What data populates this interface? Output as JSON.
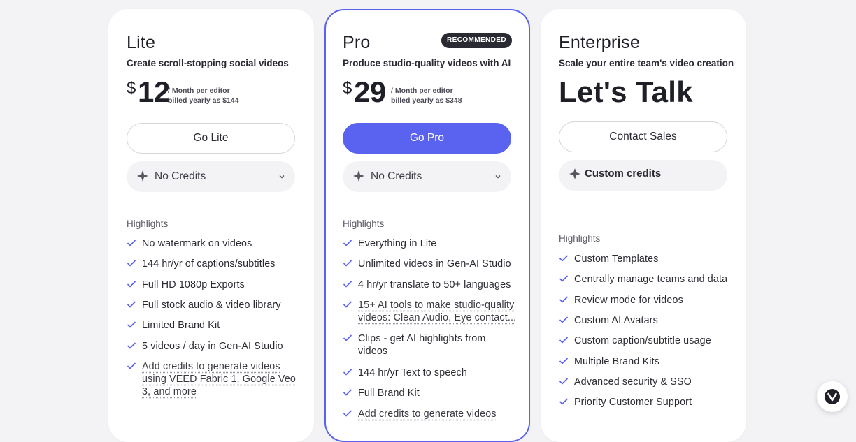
{
  "plans": {
    "lite": {
      "name": "Lite",
      "tagline": "Create scroll-stopping social videos",
      "currency": "$",
      "price": "12",
      "price_note_1": "/ Month per editor",
      "price_note_2": "billed yearly as $144",
      "cta": "Go Lite",
      "credits_label": "No Credits",
      "highlights_title": "Highlights",
      "features": [
        "No watermark on videos",
        "144 hr/yr of captions/subtitles",
        "Full HD 1080p Exports",
        "Full stock audio & video library",
        "Limited Brand Kit",
        "5 videos / day in Gen-AI Studio",
        "Add credits to generate videos using VEED Fabric 1, Google Veo 3, and more"
      ]
    },
    "pro": {
      "name": "Pro",
      "badge": "RECOMMENDED",
      "tagline": "Produce studio-quality videos with AI",
      "currency": "$",
      "price": "29",
      "price_note_1": "/ Month per editor",
      "price_note_2": "billed yearly as $348",
      "cta": "Go Pro",
      "credits_label": "No Credits",
      "highlights_title": "Highlights",
      "features": [
        "Everything in Lite",
        "Unlimited videos in Gen-AI Studio",
        "4 hr/yr translate to 50+ languages",
        "15+ AI tools to make studio-quality videos: Clean Audio, Eye contact...",
        "Clips - get AI highlights from videos",
        "144 hr/yr Text to speech",
        "Full Brand Kit",
        "Add credits to generate videos"
      ]
    },
    "enterprise": {
      "name": "Enterprise",
      "tagline": "Scale your entire team's video creation",
      "price_text": "Let's Talk",
      "cta": "Contact Sales",
      "credits_label": "Custom credits",
      "highlights_title": "Highlights",
      "features": [
        "Custom Templates",
        "Centrally manage teams and data",
        "Review mode for videos",
        "Custom AI Avatars",
        "Custom caption/subtitle usage",
        "Multiple Brand Kits",
        "Advanced security & SSO",
        "Priority Customer Support"
      ]
    }
  },
  "icons": {
    "check": "check-icon",
    "sparkle": "sparkle-icon",
    "chevron": "chevron-down-icon",
    "chat": "veed-chat-icon"
  },
  "colors": {
    "accent": "#5a63f0",
    "badge_bg": "#2a2a33",
    "check": "#5a63f0"
  }
}
